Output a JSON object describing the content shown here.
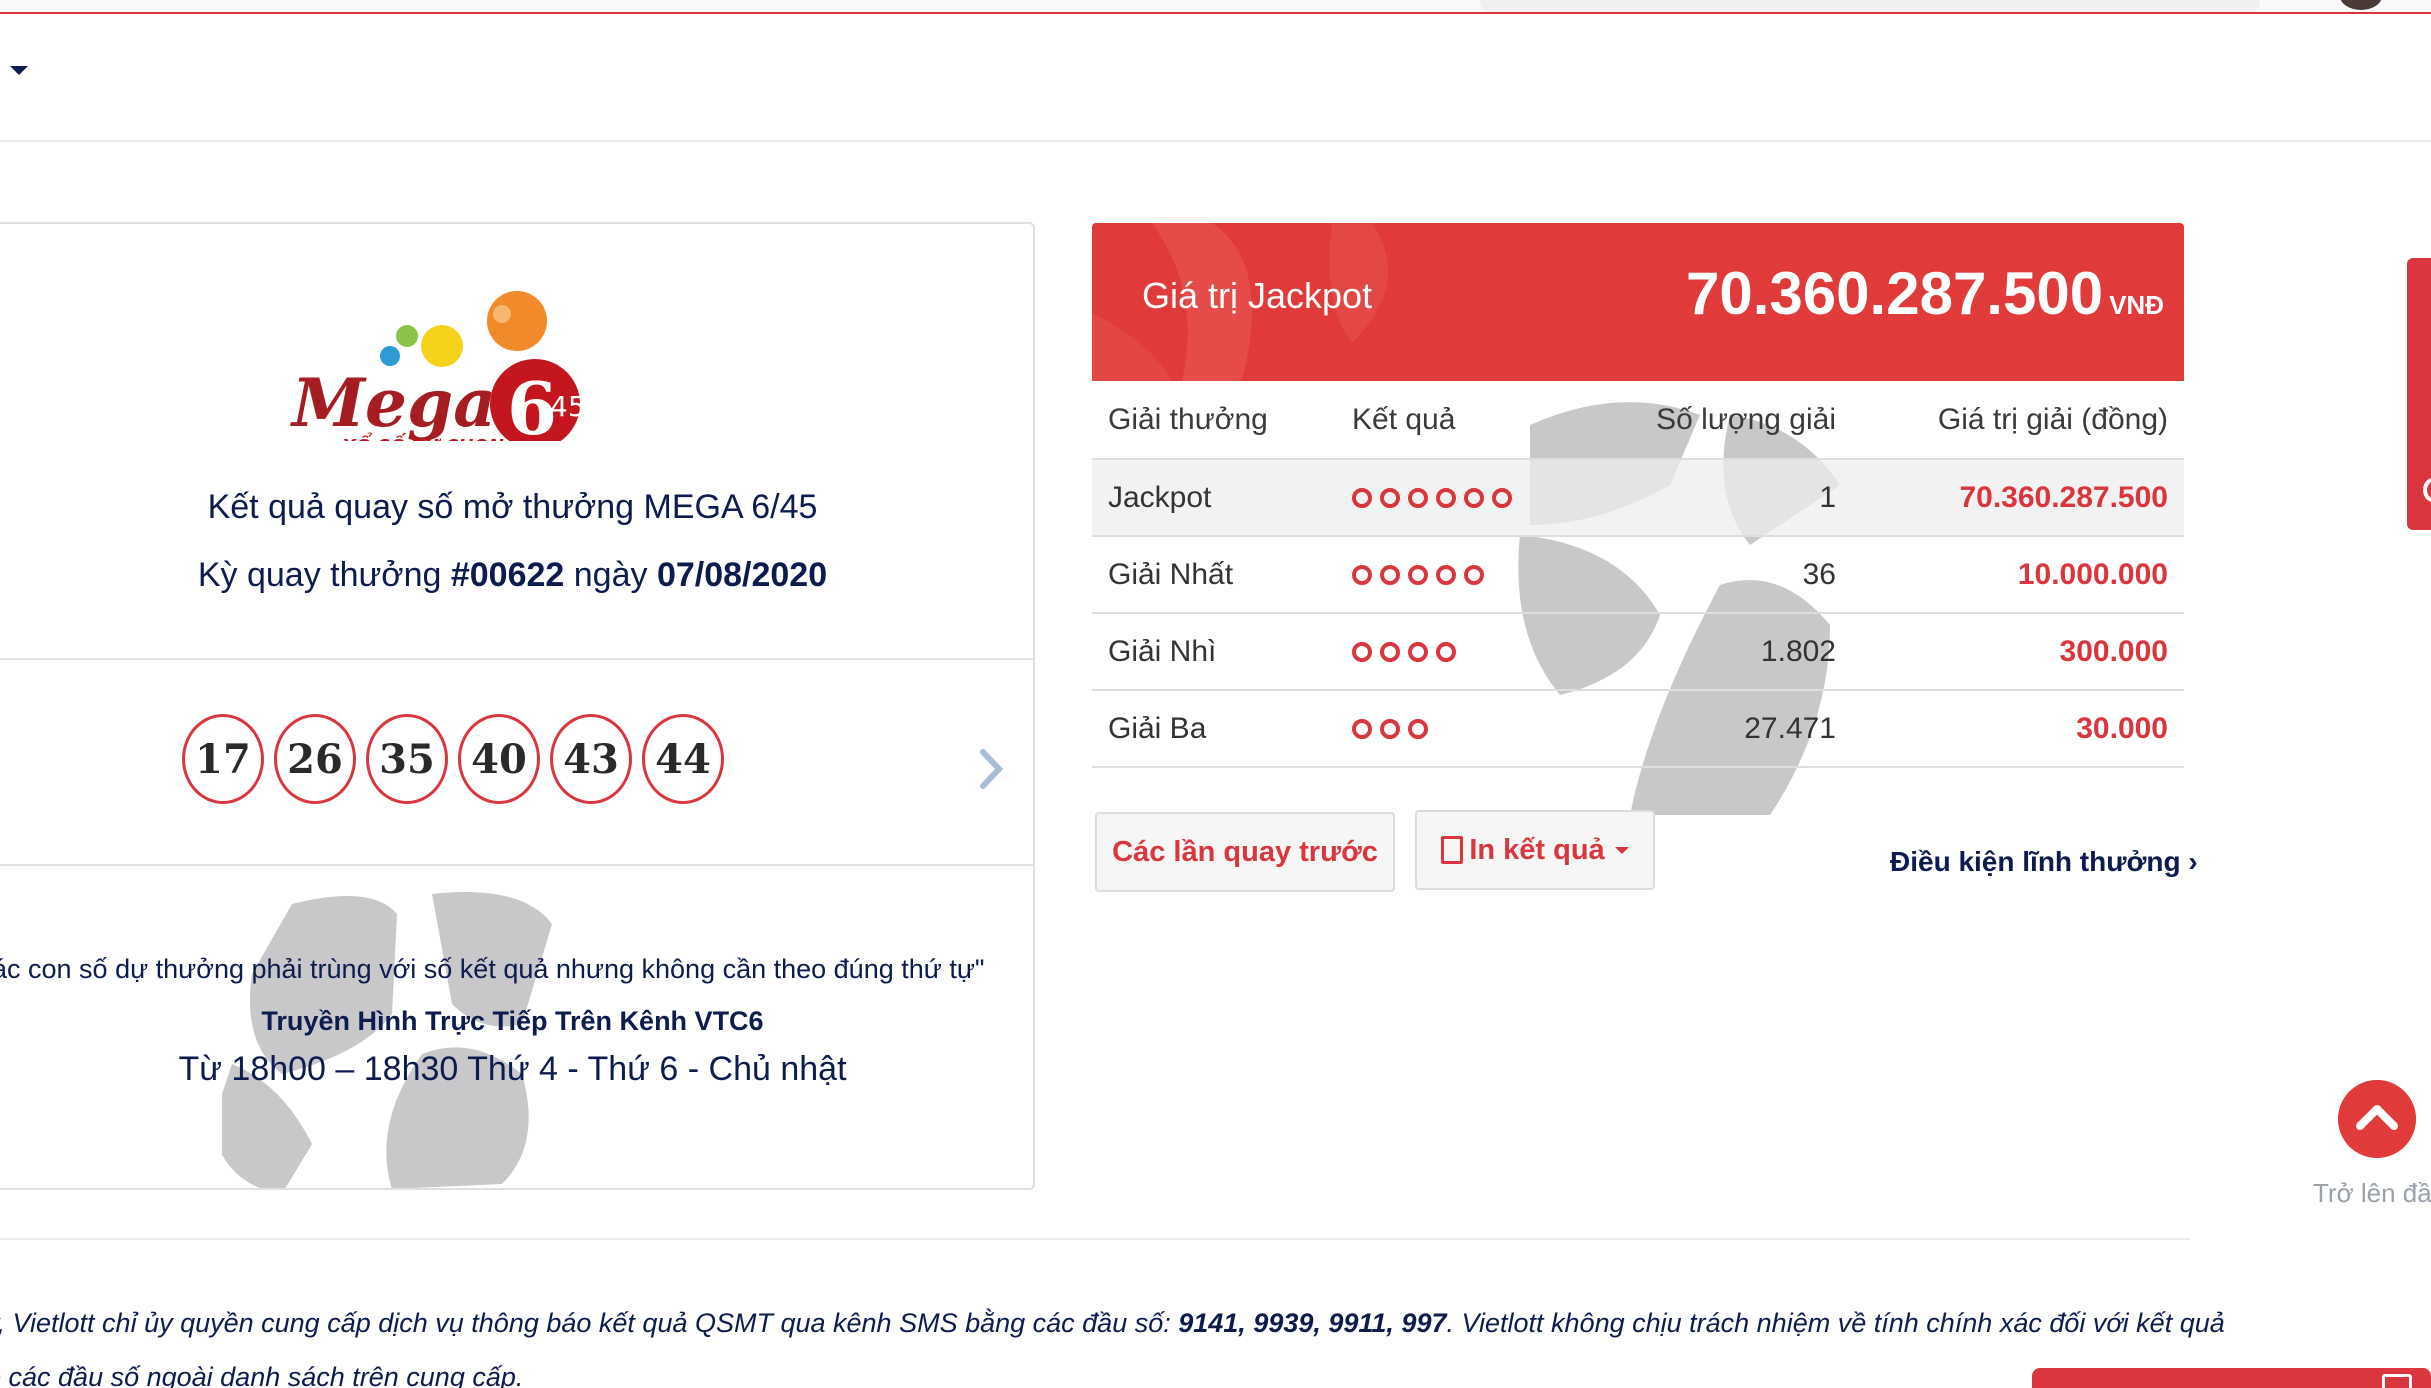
{
  "logo": {
    "brand": "Mega",
    "digit": "6",
    "sub": "45",
    "tagline": "XỔ SỐ TỰ CHỌN"
  },
  "draw": {
    "title": "Kết quả quay số mở thưởng MEGA 6/45",
    "ky_label": "Kỳ quay thưởng",
    "draw_no": "#00622",
    "ngay_label": "ngày",
    "date": "07/08/2020",
    "balls": [
      "17",
      "26",
      "35",
      "40",
      "43",
      "44"
    ]
  },
  "notes": {
    "rule": "ác con số dự thưởng phải trùng với số kết quả nhưng không cần theo đúng thứ tự\"",
    "tv": "Truyền Hình Trực Tiếp Trên Kênh VTC6",
    "schedule": "Từ 18h00 – 18h30 Thứ 4 - Thứ 6 - Chủ nhật"
  },
  "jackpot": {
    "label": "Giá trị Jackpot",
    "value": "70.360.287.500",
    "unit": "VNĐ"
  },
  "table": {
    "headers": [
      "Giải thưởng",
      "Kết quả",
      "Số lượng giải",
      "Giá trị giải (đồng)"
    ],
    "rows": [
      {
        "name": "Jackpot",
        "matches": 6,
        "count": "1",
        "value": "70.360.287.500"
      },
      {
        "name": "Giải Nhất",
        "matches": 5,
        "count": "36",
        "value": "10.000.000"
      },
      {
        "name": "Giải Nhì",
        "matches": 4,
        "count": "1.802",
        "value": "300.000"
      },
      {
        "name": "Giải Ba",
        "matches": 3,
        "count": "27.471",
        "value": "30.000"
      }
    ]
  },
  "actions": {
    "previous_draws": "Các lần quay trước",
    "print_results": "In kết quả",
    "conditions": "Điều kiện lĩnh thưởng"
  },
  "back_to_top": "Trở lên đầu",
  "disclaimer": {
    "line1_pre": "y, Vietlott chỉ ủy quyền cung cấp dịch vụ thông báo kết quả QSMT qua kênh SMS bằng các đầu số: ",
    "numbers": "9141, 9939, 9911, 997",
    "line1_post": ". Vietlott không chịu trách nhiệm về tính chính xác đối với kết quả",
    "line2": "o các đầu số ngoài danh sách trên cung cấp."
  },
  "colors": {
    "brand_red": "#d9363e",
    "navy": "#0d1b4f",
    "watermark_gray": "#c8c8ca"
  }
}
